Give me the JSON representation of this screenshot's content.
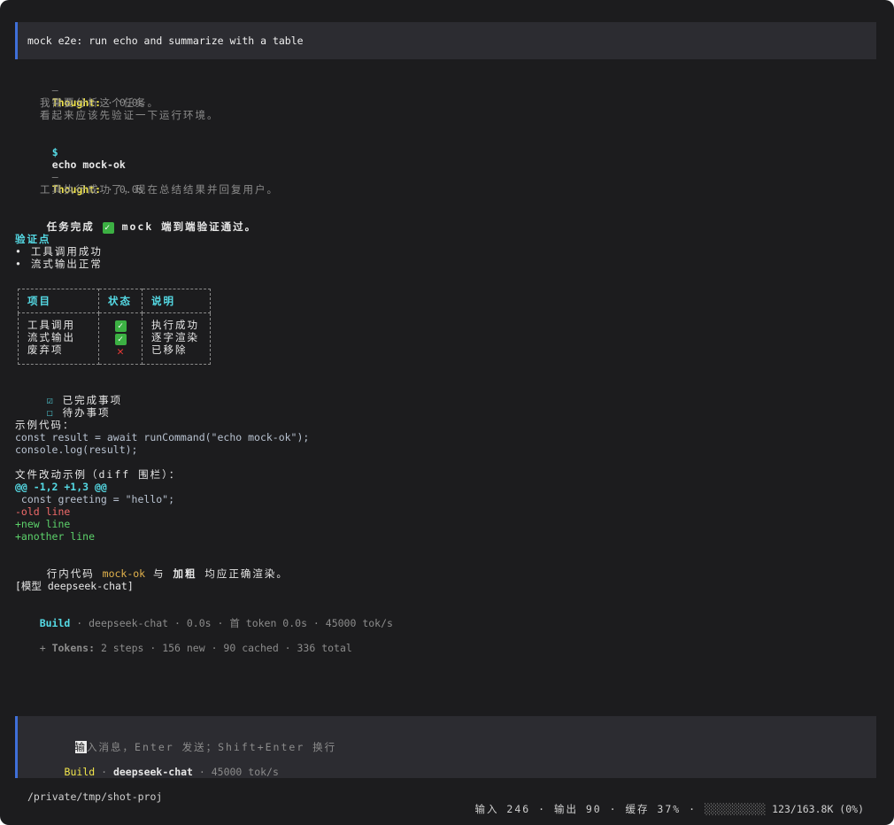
{
  "prompt": {
    "text": "mock e2e: run echo and summarize with a table"
  },
  "thought1": {
    "dash": "–",
    "label": "Thought:",
    "meta": " · 0.0s",
    "line1": "我需要分析这个任务。",
    "line2": "看起来应该先验证一下运行环境。"
  },
  "command": {
    "prompt_symbol": "$",
    "text": "echo mock-ok"
  },
  "thought2": {
    "dash": "–",
    "label": "Thought:",
    "meta": " · 0.0s",
    "line1": "工具执行成功了，现在总结结果并回复用户。"
  },
  "summary": {
    "prefix": "任务完成 ",
    "check": "✓",
    "rest": " mock 端到端验证通过。"
  },
  "checkpoints": {
    "heading": "验证点",
    "items": [
      "• 工具调用成功",
      "• 流式输出正常"
    ]
  },
  "table": {
    "headers": [
      "项目",
      "状态",
      "说明"
    ],
    "items": [
      "工具调用",
      "流式输出",
      "废弃项"
    ],
    "status": [
      "ok",
      "ok",
      "x"
    ],
    "notes": [
      "执行成功",
      "逐字渲染",
      "已移除"
    ]
  },
  "tasks": {
    "done_box": "☑",
    "done": "已完成事项",
    "todo_box": "☐",
    "todo": "待办事项"
  },
  "code": {
    "heading": "示例代码：",
    "line1": "const result = await runCommand(\"echo mock-ok\");",
    "line2": "console.log(result);"
  },
  "diff": {
    "heading": "文件改动示例（diff 围栏）：",
    "hunk": "@@ -1,2 +1,3 @@",
    "context": " const greeting = \"hello\";",
    "removed": "-old line",
    "added1": "+new line",
    "added2": "+another line"
  },
  "inline": {
    "prefix": "行内代码 ",
    "code": "mock-ok",
    "mid": " 与 ",
    "bold": "加粗",
    "suffix": " 均应正确渲染。"
  },
  "model_tag": {
    "text": "[模型 deepseek-chat]"
  },
  "status_line": {
    "mode": "Build",
    "rest": " · deepseek-chat · 0.0s · 首 token 0.0s · 45000 tok/s"
  },
  "tokens_line": {
    "prefix": "+ ",
    "label": "Tokens:",
    "rest": " 2 steps · 156 new · 90 cached · 336 total"
  },
  "input": {
    "cursor_char": "输",
    "placeholder": "入消息，Enter 发送；Shift+Enter 换行",
    "mode": "Build",
    "sep": " · ",
    "model": "deepseek-chat",
    "rate": " · 45000 tok/s"
  },
  "footer": {
    "path": "/private/tmp/shot-proj",
    "stats": "输入 246 · 输出 90 · 缓存 37% · ",
    "meter": "░░░░░░░░░░",
    "context": " 123/163.8K (0%)"
  },
  "colors": {
    "accent": "#3f6fd8",
    "yellow": "#f2e64b",
    "cyan": "#55dbe6",
    "green": "#5cd16a",
    "red": "#f06a6a",
    "orange": "#e3b34d"
  }
}
